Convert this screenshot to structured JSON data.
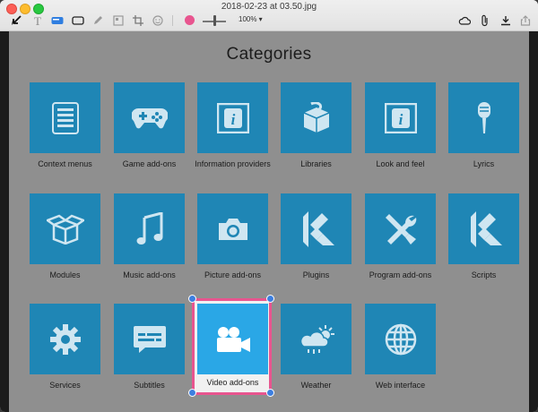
{
  "window": {
    "title": "2018-02-23 at 03.50.jpg"
  },
  "toolbar": {
    "tools": [
      "select-icon",
      "text-icon",
      "shape-filled-icon",
      "rect-icon",
      "pen-icon",
      "adjust-icon",
      "crop-icon",
      "emoji-icon"
    ],
    "stroke_color": "#e8558f",
    "zoom": "100% ▾",
    "right_tools": [
      "cloud-icon",
      "paperclip-icon",
      "download-icon",
      "share-icon"
    ]
  },
  "main": {
    "title": "Categories",
    "tile_color": "#1f86b5",
    "selected_tile_color": "#2aa7e6",
    "highlight_color": "#e8558f",
    "categories": [
      {
        "label": "Context menus",
        "icon": "menu-list-icon"
      },
      {
        "label": "Game add-ons",
        "icon": "gamepad-icon"
      },
      {
        "label": "Information providers",
        "icon": "info-panel-icon"
      },
      {
        "label": "Libraries",
        "icon": "question-box-icon"
      },
      {
        "label": "Look and feel",
        "icon": "info-panel-icon"
      },
      {
        "label": "Lyrics",
        "icon": "microphone-icon"
      },
      {
        "label": "Modules",
        "icon": "open-box-icon"
      },
      {
        "label": "Music add-ons",
        "icon": "music-note-icon"
      },
      {
        "label": "Picture add-ons",
        "icon": "camera-icon"
      },
      {
        "label": "Plugins",
        "icon": "kodi-logo-icon"
      },
      {
        "label": "Program add-ons",
        "icon": "tools-icon"
      },
      {
        "label": "Scripts",
        "icon": "kodi-logo-icon"
      },
      {
        "label": "Services",
        "icon": "gear-icon"
      },
      {
        "label": "Subtitles",
        "icon": "subtitles-icon"
      },
      {
        "label": "Video add-ons",
        "icon": "video-camera-icon",
        "selected": true
      },
      {
        "label": "Weather",
        "icon": "weather-icon"
      },
      {
        "label": "Web interface",
        "icon": "globe-icon"
      }
    ]
  }
}
